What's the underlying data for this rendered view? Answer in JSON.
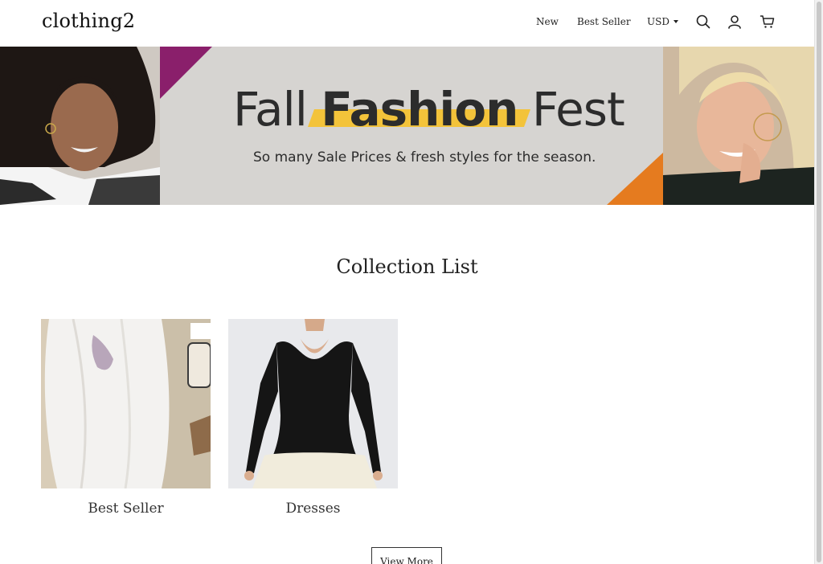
{
  "header": {
    "logo": "clothing2",
    "nav": [
      "New",
      "Best Seller"
    ],
    "currency": "USD"
  },
  "banner": {
    "title_part1": "Fall",
    "title_highlight": "Fashion",
    "title_part2": "Fest",
    "subtitle": "So many Sale Prices & fresh styles for the season."
  },
  "collection": {
    "title": "Collection List",
    "items": [
      {
        "label": "Best Seller"
      },
      {
        "label": "Dresses"
      }
    ],
    "view_more": "View More"
  },
  "colors": {
    "accent_yellow": "#f3c33a",
    "accent_purple": "#8a1f6b",
    "accent_orange": "#e57b1f"
  }
}
